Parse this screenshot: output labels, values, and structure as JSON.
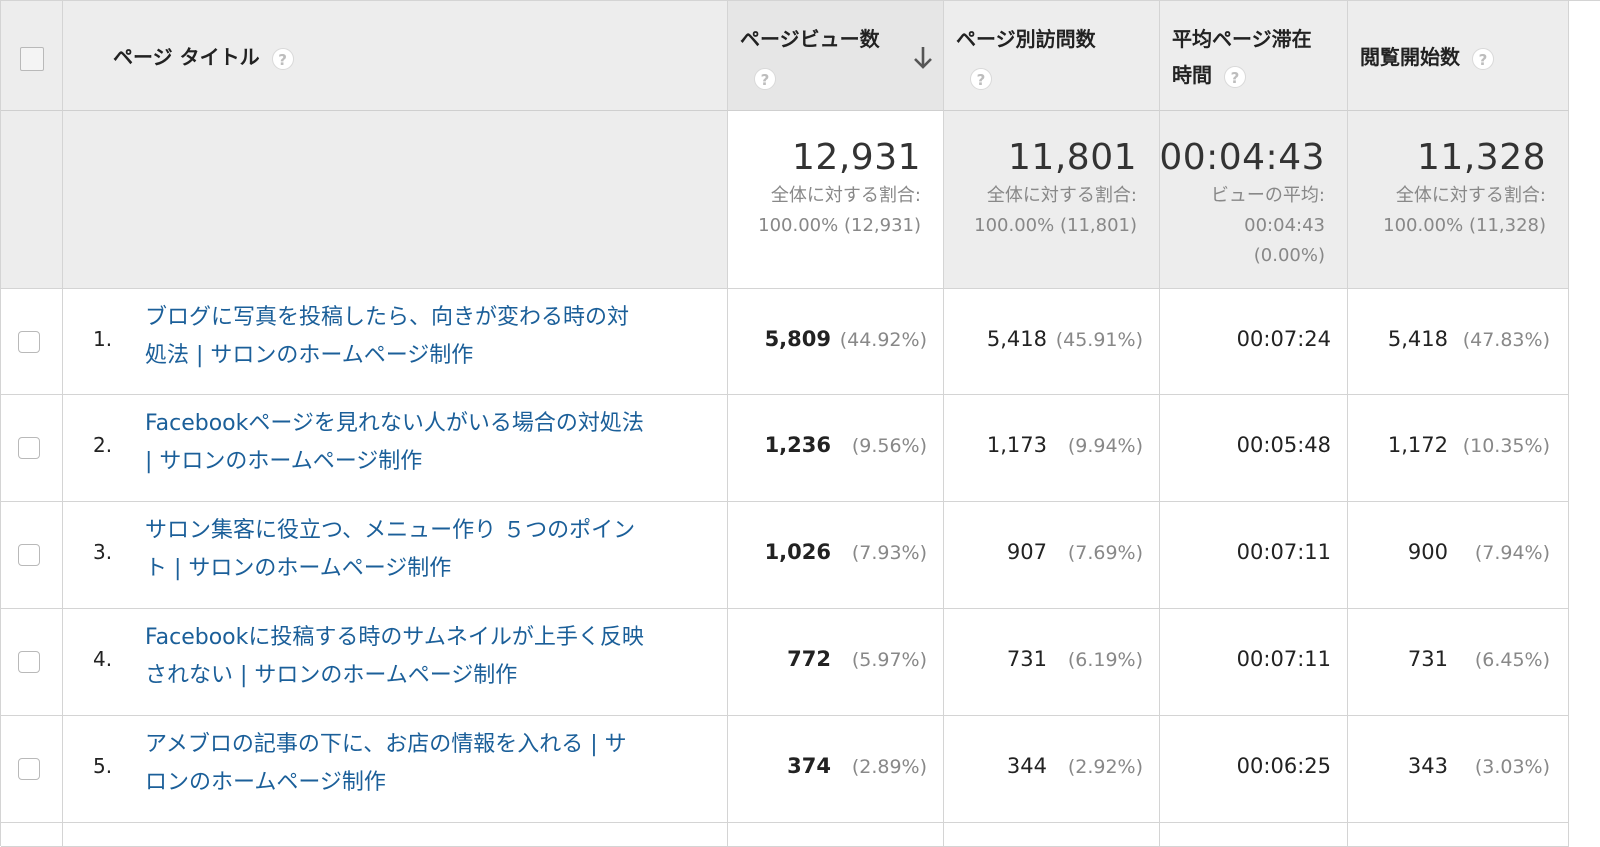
{
  "header": {
    "page_title": "ページ タイトル",
    "pageviews": "ページビュー数",
    "unique_pageviews": "ページ別訪問数",
    "avg_time_line1": "平均ページ滞在",
    "avg_time_line2": "時間",
    "entrances": "閲覧開始数",
    "help_glyph": "?"
  },
  "summary": {
    "pageviews": {
      "value": "12,931",
      "sub1": "全体に対する割合:",
      "sub2": "100.00% (12,931)"
    },
    "unique_pageviews": {
      "value": "11,801",
      "sub1": "全体に対する割合:",
      "sub2": "100.00% (11,801)"
    },
    "avg_time": {
      "value": "00:04:43",
      "sub1": "ビューの平均:",
      "sub2": "00:04:43",
      "sub3": "(0.00%)"
    },
    "entrances": {
      "value": "11,328",
      "sub1": "全体に対する割合:",
      "sub2": "100.00% (11,328)"
    }
  },
  "rows": [
    {
      "num": "1.",
      "title1": "ブログに写真を投稿したら、向きが変わる時の対",
      "title2": "処法 | サロンのホームページ制作",
      "pv": "5,809",
      "pv_pct": "(44.92%)",
      "upv": "5,418",
      "upv_pct": "(45.91%)",
      "time": "00:07:24",
      "ent": "5,418",
      "ent_pct": "(47.83%)"
    },
    {
      "num": "2.",
      "title1": "Facebookページを見れない人がいる場合の対処法",
      "title2": "| サロンのホームページ制作",
      "pv": "1,236",
      "pv_pct": "(9.56%)",
      "upv": "1,173",
      "upv_pct": "(9.94%)",
      "time": "00:05:48",
      "ent": "1,172",
      "ent_pct": "(10.35%)"
    },
    {
      "num": "3.",
      "title1": "サロン集客に役立つ、メニュー作り ５つのポイン",
      "title2": "ト | サロンのホームページ制作",
      "pv": "1,026",
      "pv_pct": "(7.93%)",
      "upv": "907",
      "upv_pct": "(7.69%)",
      "time": "00:07:11",
      "ent": "900",
      "ent_pct": "(7.94%)"
    },
    {
      "num": "4.",
      "title1": "Facebookに投稿する時のサムネイルが上手く反映",
      "title2": "されない | サロンのホームページ制作",
      "pv": "772",
      "pv_pct": "(5.97%)",
      "upv": "731",
      "upv_pct": "(6.19%)",
      "time": "00:07:11",
      "ent": "731",
      "ent_pct": "(6.45%)"
    },
    {
      "num": "5.",
      "title1": "アメブロの記事の下に、お店の情報を入れる | サ",
      "title2": "ロンのホームページ制作",
      "pv": "374",
      "pv_pct": "(2.89%)",
      "upv": "344",
      "upv_pct": "(2.92%)",
      "time": "00:06:25",
      "ent": "343",
      "ent_pct": "(3.03%)"
    }
  ]
}
